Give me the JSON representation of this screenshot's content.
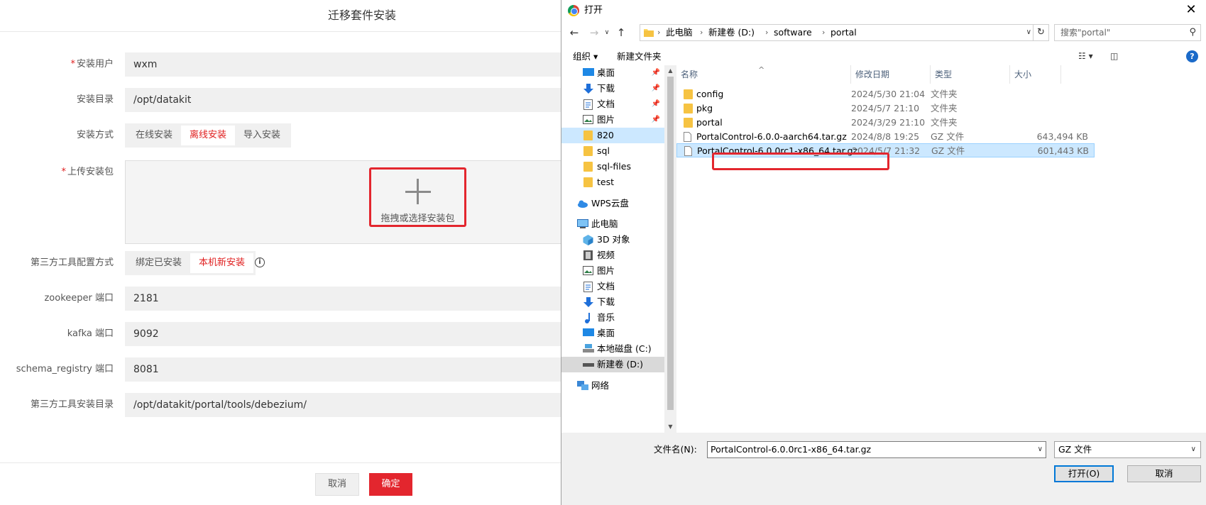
{
  "form": {
    "title": "迁移套件安装",
    "required_mark": "*",
    "install_user": {
      "label": "安装用户",
      "value": "wxm"
    },
    "install_dir": {
      "label": "安装目录",
      "value": "/opt/datakit"
    },
    "install_mode": {
      "label": "安装方式",
      "options": [
        "在线安装",
        "离线安装",
        "导入安装"
      ],
      "selected": "离线安装"
    },
    "upload": {
      "label": "上传安装包",
      "prompt": "拖拽或选择安装包"
    },
    "third_party_mode": {
      "label": "第三方工具配置方式",
      "options": [
        "绑定已安装",
        "本机新安装"
      ],
      "selected": "本机新安装",
      "info_icon": "info-icon"
    },
    "zookeeper_port": {
      "label": "zookeeper 端口",
      "value": "2181"
    },
    "kafka_port": {
      "label": "kafka 端口",
      "value": "9092"
    },
    "schema_registry_port": {
      "label": "schema_registry 端口",
      "value": "8081"
    },
    "third_party_dir": {
      "label": "第三方工具安装目录",
      "value": "/opt/datakit/portal/tools/debezium/"
    },
    "cancel_label": "取消",
    "confirm_label": "确定",
    "accent_color": "#e3262e"
  },
  "dialog": {
    "title": "打开",
    "close_icon": "close-icon",
    "breadcrumb": [
      "此电脑",
      "新建卷 (D:)",
      "software",
      "portal"
    ],
    "search_placeholder": "搜索\"portal\"",
    "toolbar": {
      "organize": "组织",
      "new_folder": "新建文件夹"
    },
    "nav_items": [
      {
        "label": "桌面",
        "icon": "desktop-icon",
        "pinned": true
      },
      {
        "label": "下载",
        "icon": "download-icon",
        "pinned": true
      },
      {
        "label": "文档",
        "icon": "document-icon",
        "pinned": true
      },
      {
        "label": "图片",
        "icon": "picture-icon",
        "pinned": true
      },
      {
        "label": "820",
        "icon": "folder-icon",
        "selected": true
      },
      {
        "label": "sql",
        "icon": "folder-icon"
      },
      {
        "label": "sql-files",
        "icon": "folder-icon"
      },
      {
        "label": "test",
        "icon": "folder-icon"
      },
      {
        "label": "WPS云盘",
        "icon": "cloud-icon"
      },
      {
        "label": "此电脑",
        "icon": "pc-icon"
      },
      {
        "label": "3D 对象",
        "icon": "3d-icon"
      },
      {
        "label": "视频",
        "icon": "video-icon"
      },
      {
        "label": "图片",
        "icon": "picture-icon"
      },
      {
        "label": "文档",
        "icon": "document-icon"
      },
      {
        "label": "下载",
        "icon": "download-icon"
      },
      {
        "label": "音乐",
        "icon": "music-icon"
      },
      {
        "label": "桌面",
        "icon": "desktop-icon"
      },
      {
        "label": "本地磁盘 (C:)",
        "icon": "drive-icon"
      },
      {
        "label": "新建卷 (D:)",
        "icon": "drive-icon",
        "current": true
      },
      {
        "label": "网络",
        "icon": "network-icon"
      }
    ],
    "columns": [
      "名称",
      "修改日期",
      "类型",
      "大小"
    ],
    "files": [
      {
        "name": "config",
        "date": "2024/5/30 21:04",
        "type": "文件夹",
        "size": "",
        "kind": "folder"
      },
      {
        "name": "pkg",
        "date": "2024/5/7 21:10",
        "type": "文件夹",
        "size": "",
        "kind": "folder"
      },
      {
        "name": "portal",
        "date": "2024/3/29 21:10",
        "type": "文件夹",
        "size": "",
        "kind": "folder"
      },
      {
        "name": "PortalControl-6.0.0-aarch64.tar.gz",
        "date": "2024/8/8 19:25",
        "type": "GZ 文件",
        "size": "643,494 KB",
        "kind": "file"
      },
      {
        "name": "PortalControl-6.0.0rc1-x86_64.tar.gz",
        "date": "2024/5/7 21:32",
        "type": "GZ 文件",
        "size": "601,443 KB",
        "kind": "file",
        "selected": true
      }
    ],
    "filename_label": "文件名(N):",
    "filename_value": "PortalControl-6.0.0rc1-x86_64.tar.gz",
    "filetype_value": "GZ 文件",
    "open_label": "打开(O)",
    "cancel_label": "取消"
  }
}
